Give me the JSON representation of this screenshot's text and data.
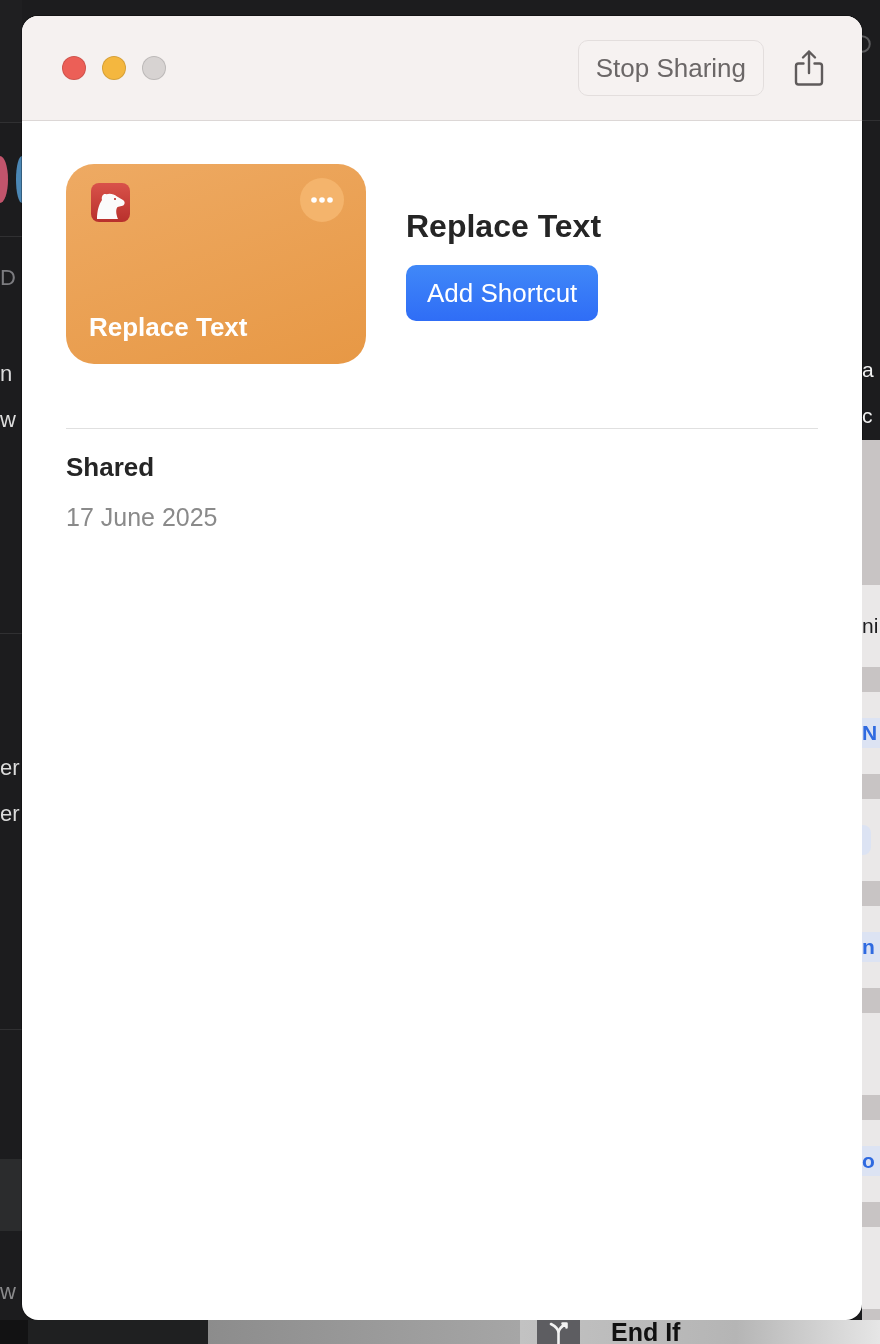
{
  "window": {
    "controls": [
      {
        "kind": "close",
        "disabled": false
      },
      {
        "kind": "minimize",
        "disabled": false
      },
      {
        "kind": "zoom",
        "disabled": true
      }
    ],
    "stop_sharing_button": "Stop Sharing"
  },
  "shortcut": {
    "card_title": "Replace Text",
    "title": "Replace Text",
    "add_button": "Add Shortcut"
  },
  "details": [
    {
      "label": "Shared",
      "value": "17 June 2025"
    }
  ],
  "background": {
    "sidebar": {
      "sections": [
        {
          "rows": [
            {
              "kind": "heading",
              "text": "D"
            },
            {
              "kind": "text",
              "text": "n"
            },
            {
              "kind": "text",
              "text": "w"
            }
          ]
        },
        {
          "rows": [
            {
              "kind": "text",
              "text": "er"
            },
            {
              "kind": "text",
              "text": "er"
            }
          ]
        },
        {
          "rows": [
            {
              "kind": "item",
              "selected": true
            },
            {
              "kind": "item",
              "selected": false,
              "text": "w"
            }
          ]
        }
      ]
    },
    "right_panel": {
      "lines": [
        "a",
        "c"
      ],
      "rows": [
        {
          "kind": "label",
          "text": "ni"
        },
        {
          "kind": "token",
          "text": "N"
        },
        {
          "kind": "token"
        },
        {
          "kind": "token",
          "text": "n"
        },
        {
          "kind": "empty"
        },
        {
          "kind": "token",
          "text": "o"
        },
        {
          "kind": "empty"
        }
      ]
    },
    "bottom_row": {
      "title": "End If"
    }
  }
}
